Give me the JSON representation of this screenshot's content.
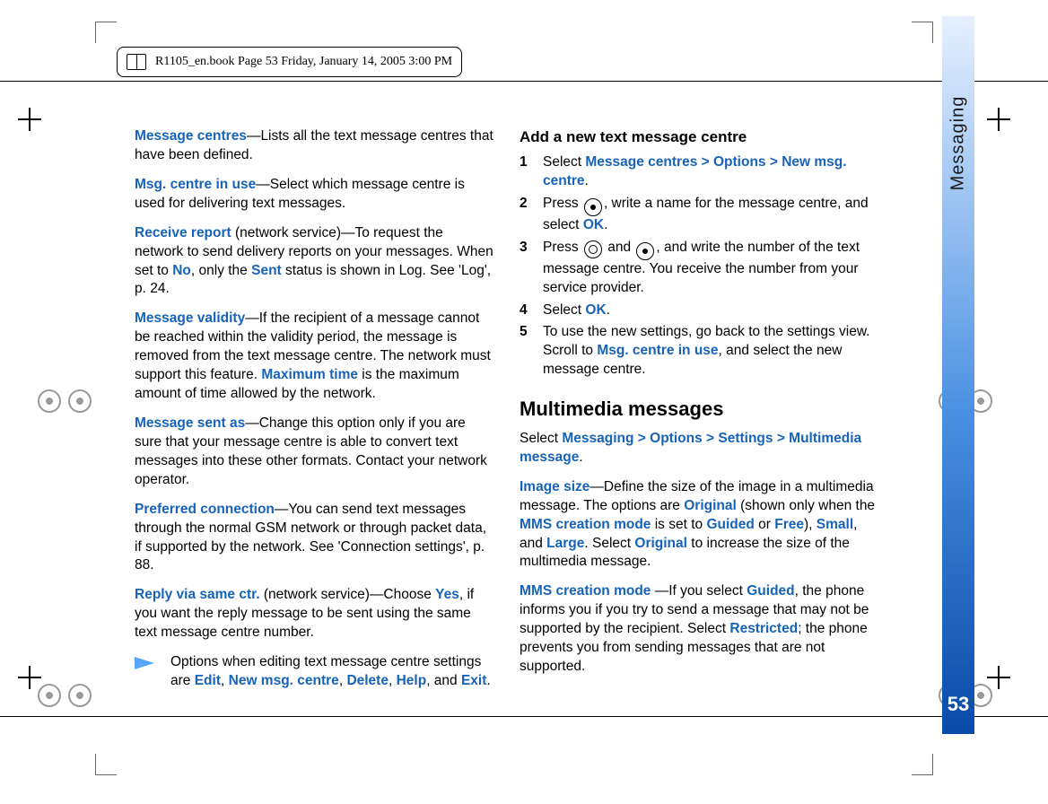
{
  "header": {
    "text": "R1105_en.book  Page 53  Friday, January 14, 2005  3:00 PM"
  },
  "sidebar": {
    "section_label": "Messaging",
    "page_number": "53"
  },
  "left_column": {
    "p1": {
      "term": "Message centres",
      "rest": "—Lists all the text message centres that have been defined."
    },
    "p2": {
      "term": "Msg. centre in use",
      "rest": "—Select which message centre is used for delivering text messages."
    },
    "p3": {
      "term": "Receive report",
      "mid1": " (network service)—To request the network to send delivery reports on your messages. When set to ",
      "no": "No",
      "mid2": ", only the ",
      "sent": "Sent",
      "rest": " status is shown in Log. See 'Log', p. 24."
    },
    "p4": {
      "term": "Message validity",
      "mid1": "—If the recipient of a message cannot be reached within the validity period, the message is removed from the text message centre. The network must support this feature. ",
      "max": "Maximum time",
      "rest": " is the maximum amount of time allowed by the network."
    },
    "p5": {
      "term": "Message sent as",
      "rest": "—Change this option only if you are sure that your message centre is able to convert text messages into these other formats. Contact your network operator."
    },
    "p6": {
      "term": "Preferred connection",
      "rest": "—You can send text messages through the normal GSM network or through packet data, if supported by the network. See 'Connection settings', p. 88."
    },
    "p7": {
      "term": "Reply via same ctr.",
      "mid1": " (network service)—Choose ",
      "yes": "Yes",
      "rest": ", if you want the reply message to be sent using the same text message centre number."
    },
    "note": {
      "lead": "Options when editing text message centre settings are ",
      "o1": "Edit",
      "c1": ", ",
      "o2": "New msg. centre",
      "c2": ", ",
      "o3": "Delete",
      "c3": ", ",
      "o4": "Help",
      "c4": ", and ",
      "o5": "Exit",
      "end": "."
    }
  },
  "right_column": {
    "sub1": "Add a new text message centre",
    "steps": {
      "s1": {
        "a": "Select ",
        "b": "Message centres > Options > New msg. centre",
        "c": "."
      },
      "s2": {
        "a": "Press ",
        "b": ", write a name for the message centre, and select ",
        "ok": "OK",
        "c": "."
      },
      "s3": {
        "a": "Press ",
        "b": " and ",
        "c": ", and write the number of the text message centre. You receive the number from your service provider."
      },
      "s4": {
        "a": "Select ",
        "ok": "OK",
        "b": "."
      },
      "s5": {
        "a": "To use the new settings, go back to the settings view. Scroll to ",
        "b": "Msg. centre in use",
        "c": ", and select the new message centre."
      }
    },
    "h2": "Multimedia messages",
    "mm_path": {
      "a": "Select ",
      "b": "Messaging > Options > Settings > Multimedia message",
      "c": "."
    },
    "img_size": {
      "term": "Image size",
      "a": "—Define the size of the image in a multimedia message. The options are ",
      "orig": "Original",
      "b": " (shown only when the ",
      "mode": "MMS creation mode",
      "c": " is set to ",
      "guided": "Guided",
      "d": " or ",
      "free": "Free",
      "e": "), ",
      "small": "Small",
      "f": ", and ",
      "large": "Large",
      "g": ". Select ",
      "orig2": "Original",
      "h": " to increase the size of the multimedia message."
    },
    "mms_mode": {
      "term": "MMS creation mode ",
      "a": "—If you select ",
      "guided": "Guided",
      "b": ", the phone informs you if you try to send a message that may not be supported by the recipient. Select ",
      "restricted": "Restricted",
      "c": "; the phone prevents you from sending messages that are not supported."
    }
  }
}
